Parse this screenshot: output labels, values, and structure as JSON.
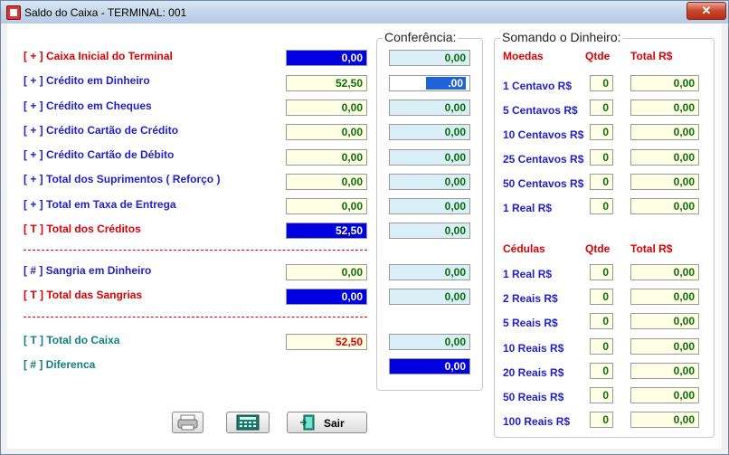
{
  "window": {
    "title": "Saldo do Caixa - TERMINAL: 001",
    "close_glyph": "✕"
  },
  "left": {
    "rows": [
      {
        "label": "[ + ] Caixa Inicial do Terminal",
        "value": "0,00",
        "conf": "0,00"
      },
      {
        "label": "[ + ] Crédito em Dinheiro",
        "value": "52,50",
        "conf": ".00"
      },
      {
        "label": "[ + ] Crédito em Cheques",
        "value": "0,00",
        "conf": "0,00"
      },
      {
        "label": "[ + ] Crédito Cartão de Crédito",
        "value": "0,00",
        "conf": "0,00"
      },
      {
        "label": "[ + ] Crédito Cartão de Débito",
        "value": "0,00",
        "conf": "0,00"
      },
      {
        "label": "[ + ] Total dos Suprimentos ( Reforço )",
        "value": "0,00",
        "conf": "0,00"
      },
      {
        "label": "[ + ] Total em Taxa de Entrega",
        "value": "0,00",
        "conf": "0,00"
      },
      {
        "label": "[ T ] Total dos Créditos",
        "value": "52,50",
        "conf": "0,00"
      },
      {
        "label": "[ # ] Sangria em Dinheiro",
        "value": "0,00",
        "conf": "0,00"
      },
      {
        "label": "[ T ] Total das Sangrias",
        "value": "0,00",
        "conf": "0,00"
      },
      {
        "label": "[ T ] Total do Caixa",
        "value": "52,50",
        "conf": "0,00"
      },
      {
        "label": "[ # ] Diferenca",
        "conf": "0,00"
      }
    ]
  },
  "conferencia": {
    "title": "Conferência:"
  },
  "somando": {
    "title": "Somando o Dinheiro:",
    "moedas": {
      "header": "Moedas",
      "qtde_header": "Qtde",
      "total_header": "Total R$",
      "rows": [
        {
          "label": "1 Centavo R$",
          "qtde": "0",
          "total": "0,00"
        },
        {
          "label": "5 Centavos R$",
          "qtde": "0",
          "total": "0,00"
        },
        {
          "label": "10 Centavos R$",
          "qtde": "0",
          "total": "0,00"
        },
        {
          "label": "25 Centavos R$",
          "qtde": "0",
          "total": "0,00"
        },
        {
          "label": "50 Centavos R$",
          "qtde": "0",
          "total": "0,00"
        },
        {
          "label": "1 Real R$",
          "qtde": "0",
          "total": "0,00"
        }
      ]
    },
    "cedulas": {
      "header": "Cédulas",
      "qtde_header": "Qtde",
      "total_header": "Total R$",
      "rows": [
        {
          "label": "1 Real R$",
          "qtde": "0",
          "total": "0,00"
        },
        {
          "label": "2 Reais R$",
          "qtde": "0",
          "total": "0,00"
        },
        {
          "label": "5 Reais R$",
          "qtde": "0",
          "total": "0,00"
        },
        {
          "label": "10 Reais R$",
          "qtde": "0",
          "total": "0,00"
        },
        {
          "label": "20 Reais R$",
          "qtde": "0",
          "total": "0,00"
        },
        {
          "label": "50 Reais R$",
          "qtde": "0",
          "total": "0,00"
        },
        {
          "label": "100 Reais R$",
          "qtde": "0",
          "total": "0,00"
        }
      ]
    }
  },
  "buttons": {
    "sair": "Sair"
  },
  "icons": {
    "print": "printer-icon",
    "calc": "calculator-icon",
    "exit": "exit-door-icon"
  },
  "colors": {
    "accent_dark": "#0000e0",
    "label_red": "#e00000",
    "label_blue": "#1f1fd0",
    "label_teal": "#108080"
  }
}
